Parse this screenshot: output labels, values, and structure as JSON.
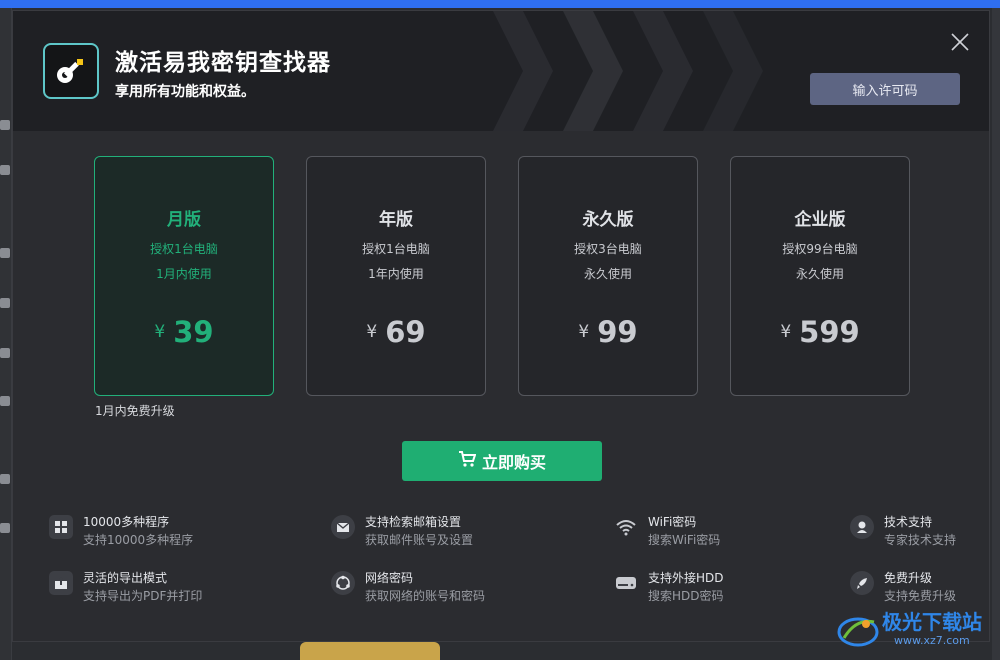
{
  "app": {
    "title": "激活易我密钥查找器",
    "subtitle": "享用所有功能和权益。",
    "license_button": "输入许可码",
    "close_icon": "close-icon",
    "logo_icon": "key-icon"
  },
  "plans": [
    {
      "name": "月版",
      "line1": "授权1台电脑",
      "line2": "1月内使用",
      "currency": "¥",
      "price": "39",
      "selected": true
    },
    {
      "name": "年版",
      "line1": "授权1台电脑",
      "line2": "1年内使用",
      "currency": "¥",
      "price": "69",
      "selected": false
    },
    {
      "name": "永久版",
      "line1": "授权3台电脑",
      "line2": "永久使用",
      "currency": "¥",
      "price": "99",
      "selected": false
    },
    {
      "name": "企业版",
      "line1": "授权99台电脑",
      "line2": "永久使用",
      "currency": "¥",
      "price": "599",
      "selected": false
    }
  ],
  "upgrade_note": "1月内免费升级",
  "buy_button": "立即购买",
  "features": [
    {
      "title": "10000多种程序",
      "sub": "支持10000多种程序",
      "icon": "apps-grid-icon"
    },
    {
      "title": "支持检索邮箱设置",
      "sub": "获取邮件账号及设置",
      "icon": "mail-icon"
    },
    {
      "title": "WiFi密码",
      "sub": "搜索WiFi密码",
      "icon": "wifi-icon"
    },
    {
      "title": "技术支持",
      "sub": "专家技术支持",
      "icon": "support-icon"
    },
    {
      "title": "灵活的导出模式",
      "sub": "支持导出为PDF并打印",
      "icon": "export-icon"
    },
    {
      "title": "网络密码",
      "sub": "获取网络的账号和密码",
      "icon": "network-icon"
    },
    {
      "title": "支持外接HDD",
      "sub": "搜索HDD密码",
      "icon": "hdd-icon"
    },
    {
      "title": "免费升级",
      "sub": "支持免费升级",
      "icon": "rocket-icon"
    }
  ],
  "watermark": {
    "text": "极光下载站",
    "url": "www.xz7.com"
  },
  "colors": {
    "accent_green": "#22b07a",
    "buy_green": "#1fae72",
    "license_button": "#5d6583",
    "header_bg": "#1f2024"
  }
}
